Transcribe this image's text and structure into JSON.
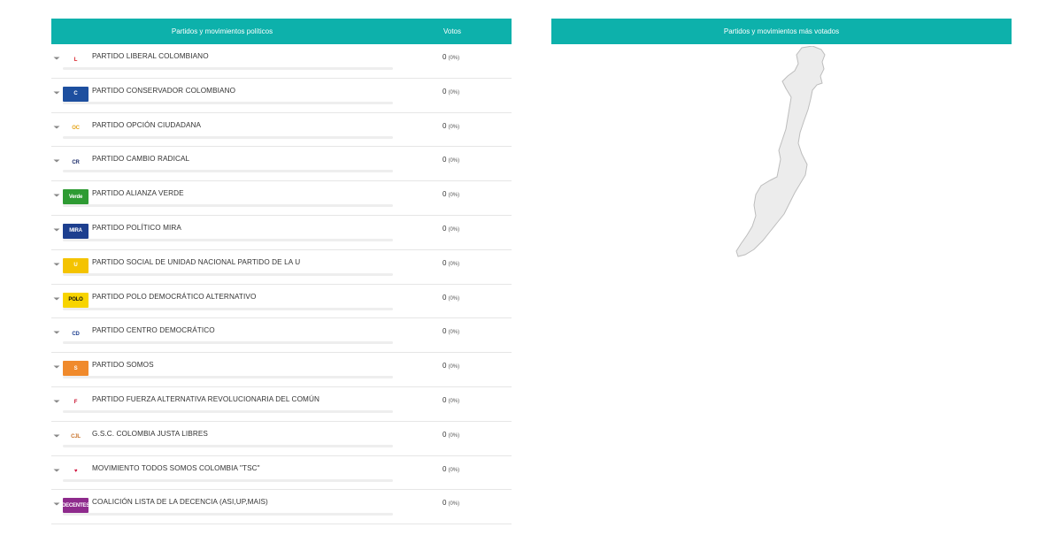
{
  "left_table": {
    "col_party": "Partidos y movimientos políticos",
    "col_votes": "Votos"
  },
  "right_panel": {
    "title": "Partidos y movimientos más votados"
  },
  "parties": [
    {
      "name": "PARTIDO LIBERAL COLOMBIANO",
      "votes": "0",
      "pct": "(0%)",
      "share": 0,
      "logo_text": "L",
      "logo_bg": "#ffffff",
      "logo_fg": "#d7181f"
    },
    {
      "name": "PARTIDO CONSERVADOR COLOMBIANO",
      "votes": "0",
      "pct": "(0%)",
      "share": 0,
      "logo_text": "C",
      "logo_bg": "#1d4f9f",
      "logo_fg": "#ffffff"
    },
    {
      "name": "PARTIDO OPCIÓN CIUDADANA",
      "votes": "0",
      "pct": "(0%)",
      "share": 0,
      "logo_text": "OC",
      "logo_bg": "#ffffff",
      "logo_fg": "#e5a51b"
    },
    {
      "name": "PARTIDO CAMBIO RADICAL",
      "votes": "0",
      "pct": "(0%)",
      "share": 0,
      "logo_text": "CR",
      "logo_bg": "#ffffff",
      "logo_fg": "#1d2d6b"
    },
    {
      "name": "PARTIDO ALIANZA VERDE",
      "votes": "0",
      "pct": "(0%)",
      "share": 0,
      "logo_text": "Verde",
      "logo_bg": "#2e9b33",
      "logo_fg": "#ffffff"
    },
    {
      "name": "PARTIDO POLÍTICO MIRA",
      "votes": "0",
      "pct": "(0%)",
      "share": 0,
      "logo_text": "MIRA",
      "logo_bg": "#1d3f8f",
      "logo_fg": "#ffffff"
    },
    {
      "name": "PARTIDO SOCIAL DE UNIDAD NACIONAL PARTIDO DE LA U",
      "votes": "0",
      "pct": "(0%)",
      "share": 0,
      "logo_text": "U",
      "logo_bg": "#f4c300",
      "logo_fg": "#ffffff"
    },
    {
      "name": "PARTIDO POLO DEMOCRÁTICO ALTERNATIVO",
      "votes": "0",
      "pct": "(0%)",
      "share": 0,
      "logo_text": "POLO",
      "logo_bg": "#f7d400",
      "logo_fg": "#111111"
    },
    {
      "name": "PARTIDO CENTRO DEMOCRÁTICO",
      "votes": "0",
      "pct": "(0%)",
      "share": 0,
      "logo_text": "CD",
      "logo_bg": "#ffffff",
      "logo_fg": "#1d3f8f"
    },
    {
      "name": "PARTIDO SOMOS",
      "votes": "0",
      "pct": "(0%)",
      "share": 0,
      "logo_text": "S",
      "logo_bg": "#f08a2c",
      "logo_fg": "#ffffff"
    },
    {
      "name": "PARTIDO FUERZA ALTERNATIVA REVOLUCIONARIA DEL COMÚN",
      "votes": "0",
      "pct": "(0%)",
      "share": 0,
      "logo_text": "F",
      "logo_bg": "#ffffff",
      "logo_fg": "#c8102e"
    },
    {
      "name": "G.S.C. COLOMBIA JUSTA LIBRES",
      "votes": "0",
      "pct": "(0%)",
      "share": 0,
      "logo_text": "CJL",
      "logo_bg": "#ffffff",
      "logo_fg": "#c8732b"
    },
    {
      "name": "MOVIMIENTO TODOS SOMOS COLOMBIA \"TSC\"",
      "votes": "0",
      "pct": "(0%)",
      "share": 0,
      "logo_text": "♥",
      "logo_bg": "#ffffff",
      "logo_fg": "#d0103a"
    },
    {
      "name": "COALICIÓN LISTA DE LA DECENCIA (ASI,UP,MAIS)",
      "votes": "0",
      "pct": "(0%)",
      "share": 0,
      "logo_text": "DECENTES",
      "logo_bg": "#8e2a8c",
      "logo_fg": "#ffffff"
    }
  ],
  "colors": {
    "accent": "#0db1ab",
    "map_fill": "#ececec",
    "map_stroke": "#bdbdbd"
  },
  "icons": {
    "row_toggle": "chevron-down-icon",
    "map": "colombia-map-icon"
  }
}
